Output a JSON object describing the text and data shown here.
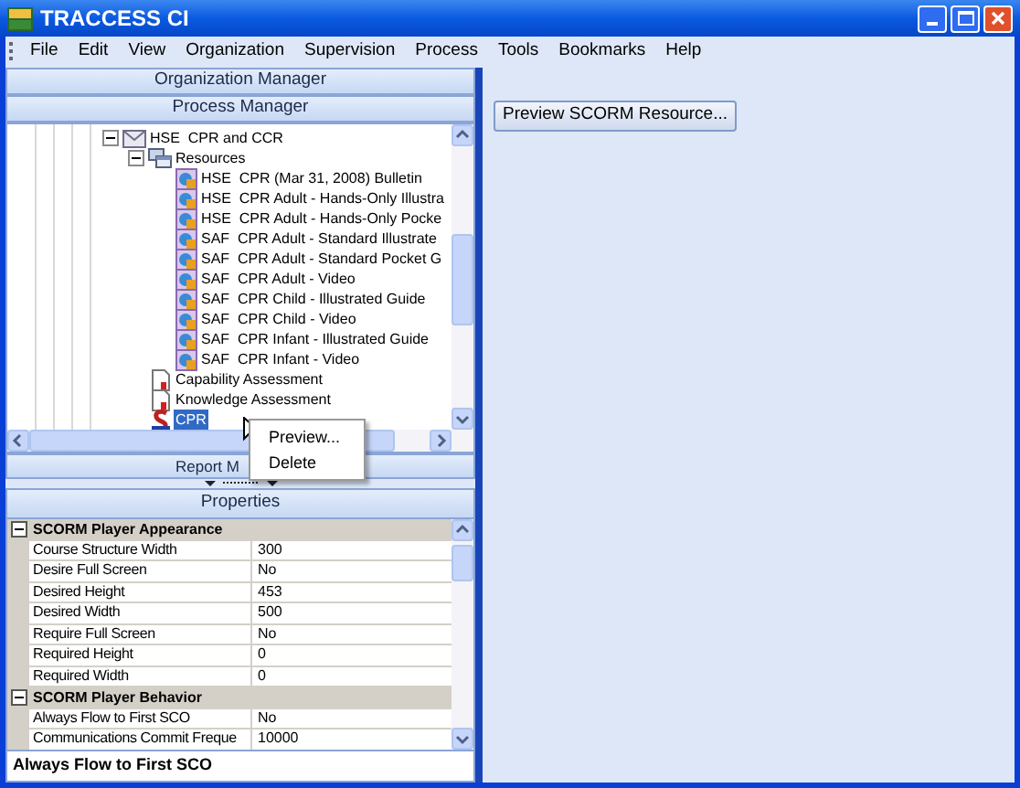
{
  "window": {
    "title": "TRACCESS CI"
  },
  "menu": [
    "File",
    "Edit",
    "View",
    "Organization",
    "Supervision",
    "Process",
    "Tools",
    "Bookmarks",
    "Help"
  ],
  "left_panel": {
    "sections": [
      "Organization Manager",
      "Process Manager"
    ],
    "tree": [
      {
        "label": "HSE  CPR and CCR",
        "kind": "course",
        "expanded": true,
        "selected": false,
        "children": [
          {
            "label": "Resources",
            "kind": "folder",
            "expanded": true,
            "selected": false,
            "children": [
              {
                "label": "HSE  CPR (Mar 31, 2008) Bulletin",
                "kind": "resource",
                "selected": false
              },
              {
                "label": "HSE  CPR Adult - Hands-Only Illustra",
                "kind": "resource",
                "selected": false
              },
              {
                "label": "HSE  CPR Adult - Hands-Only Pocke",
                "kind": "resource",
                "selected": false
              },
              {
                "label": "SAF  CPR Adult - Standard Illustrate",
                "kind": "resource",
                "selected": false
              },
              {
                "label": "SAF  CPR Adult - Standard Pocket G",
                "kind": "resource",
                "selected": false
              },
              {
                "label": "SAF  CPR Adult - Video",
                "kind": "resource",
                "selected": false
              },
              {
                "label": "SAF  CPR Child - Illustrated Guide",
                "kind": "resource",
                "selected": false
              },
              {
                "label": "SAF  CPR Child - Video",
                "kind": "resource",
                "selected": false
              },
              {
                "label": "SAF  CPR Infant - Illustrated Guide",
                "kind": "resource",
                "selected": false
              },
              {
                "label": "SAF  CPR Infant - Video",
                "kind": "resource",
                "selected": false
              }
            ]
          },
          {
            "label": "Capability Assessment",
            "kind": "assessment",
            "selected": false
          },
          {
            "label": "Knowledge Assessment",
            "kind": "assessment",
            "selected": false
          },
          {
            "label": "CPR",
            "kind": "scorm",
            "selected": true
          }
        ]
      }
    ],
    "report_bar": "Report M"
  },
  "context_menu": {
    "items": [
      "Preview...",
      "Delete"
    ]
  },
  "properties": {
    "title": "Properties",
    "categories": [
      {
        "name": "SCORM Player Appearance",
        "expanded": true,
        "rows": [
          {
            "name": "Course Structure Width",
            "value": "300"
          },
          {
            "name": "Desire Full Screen",
            "value": "No"
          },
          {
            "name": "Desired Height",
            "value": "453"
          },
          {
            "name": "Desired Width",
            "value": "500"
          },
          {
            "name": "Require Full Screen",
            "value": "No"
          },
          {
            "name": "Required Height",
            "value": "0"
          },
          {
            "name": "Required Width",
            "value": "0"
          }
        ]
      },
      {
        "name": "SCORM Player Behavior",
        "expanded": true,
        "rows": [
          {
            "name": "Always Flow to First SCO",
            "value": "No"
          },
          {
            "name": "Communications Commit Freque",
            "value": "10000"
          }
        ]
      }
    ],
    "description": "Always Flow to First SCO"
  },
  "right_panel": {
    "button": "Preview SCORM Resource..."
  }
}
